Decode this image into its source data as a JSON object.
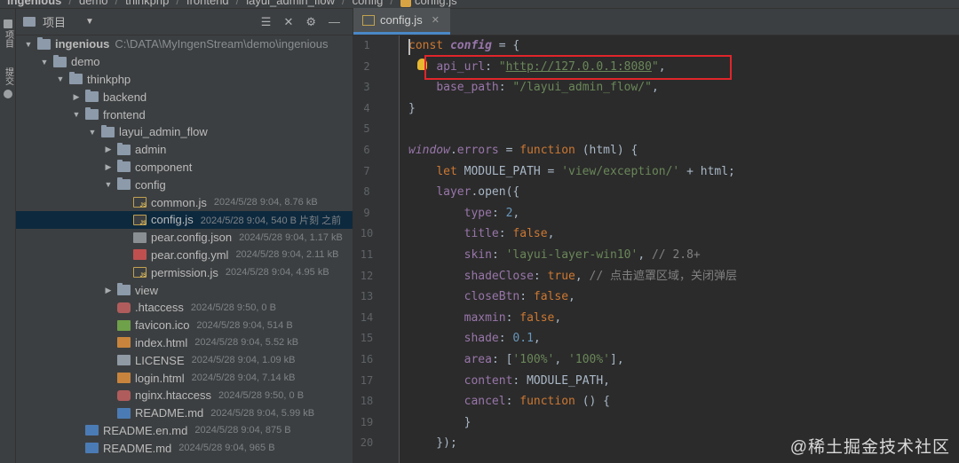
{
  "breadcrumb": {
    "items": [
      "ingenious",
      "demo",
      "thinkphp",
      "frontend",
      "layui_admin_flow",
      "config",
      "config.js"
    ]
  },
  "toolstrip": {
    "project_label": "项目",
    "commit_label": "提交"
  },
  "project_panel": {
    "title": "项目",
    "tree": [
      {
        "name": "ingenious",
        "path": "C:\\DATA\\MyIngenStream\\demo\\ingenious",
        "meta": "",
        "type": "folder",
        "depth": 0,
        "expanded": true
      },
      {
        "name": "demo",
        "path": "",
        "meta": "",
        "type": "folder",
        "depth": 1,
        "expanded": true
      },
      {
        "name": "thinkphp",
        "path": "",
        "meta": "",
        "type": "folder",
        "depth": 2,
        "expanded": true
      },
      {
        "name": "backend",
        "path": "",
        "meta": "",
        "type": "folder",
        "depth": 3,
        "expanded": false
      },
      {
        "name": "frontend",
        "path": "",
        "meta": "",
        "type": "folder",
        "depth": 3,
        "expanded": true
      },
      {
        "name": "layui_admin_flow",
        "path": "",
        "meta": "",
        "type": "folder",
        "depth": 4,
        "expanded": true
      },
      {
        "name": "admin",
        "path": "",
        "meta": "",
        "type": "folder",
        "depth": 5,
        "expanded": false
      },
      {
        "name": "component",
        "path": "",
        "meta": "",
        "type": "folder",
        "depth": 5,
        "expanded": false
      },
      {
        "name": "config",
        "path": "",
        "meta": "",
        "type": "folder",
        "depth": 5,
        "expanded": true
      },
      {
        "name": "common.js",
        "path": "",
        "meta": "2024/5/28 9:04, 8.76 kB",
        "type": "js",
        "depth": 6
      },
      {
        "name": "config.js",
        "path": "",
        "meta": "2024/5/28 9:04, 540 B 片刻 之前",
        "type": "js",
        "depth": 6,
        "selected": true
      },
      {
        "name": "pear.config.json",
        "path": "",
        "meta": "2024/5/28 9:04, 1.17 kB",
        "type": "json",
        "depth": 6
      },
      {
        "name": "pear.config.yml",
        "path": "",
        "meta": "2024/5/28 9:04, 2.11 kB",
        "type": "yml",
        "depth": 6
      },
      {
        "name": "permission.js",
        "path": "",
        "meta": "2024/5/28 9:04, 4.95 kB",
        "type": "js",
        "depth": 6
      },
      {
        "name": "view",
        "path": "",
        "meta": "",
        "type": "folder",
        "depth": 5,
        "expanded": false
      },
      {
        "name": ".htaccess",
        "path": "",
        "meta": "2024/5/28 9:50, 0 B",
        "type": "ht",
        "depth": 5
      },
      {
        "name": "favicon.ico",
        "path": "",
        "meta": "2024/5/28 9:04, 514 B",
        "type": "ico",
        "depth": 5
      },
      {
        "name": "index.html",
        "path": "",
        "meta": "2024/5/28 9:04, 5.52 kB",
        "type": "html",
        "depth": 5
      },
      {
        "name": "LICENSE",
        "path": "",
        "meta": "2024/5/28 9:04, 1.09 kB",
        "type": "lic",
        "depth": 5
      },
      {
        "name": "login.html",
        "path": "",
        "meta": "2024/5/28 9:04, 7.14 kB",
        "type": "html",
        "depth": 5
      },
      {
        "name": "nginx.htaccess",
        "path": "",
        "meta": "2024/5/28 9:50, 0 B",
        "type": "ht",
        "depth": 5
      },
      {
        "name": "README.md",
        "path": "",
        "meta": "2024/5/28 9:04, 5.99 kB",
        "type": "md",
        "depth": 5
      },
      {
        "name": "README.en.md",
        "path": "",
        "meta": "2024/5/28 9:04, 875 B",
        "type": "md",
        "depth": 3
      },
      {
        "name": "README.md",
        "path": "",
        "meta": "2024/5/28 9:04, 965 B",
        "type": "md",
        "depth": 3
      }
    ]
  },
  "editor": {
    "tab_label": "config.js",
    "line_numbers": [
      "1",
      "2",
      "3",
      "4",
      "5",
      "6",
      "7",
      "8",
      "9",
      "10",
      "11",
      "12",
      "13",
      "14",
      "15",
      "16",
      "17",
      "18",
      "19",
      "20"
    ]
  },
  "watermark": "@稀土掘金技术社区",
  "colors": {
    "highlight_box": "#e0252b",
    "selection": "#0d293e",
    "keyword": "#cc7832",
    "string": "#6a8759",
    "number": "#6897bb",
    "property": "#9876aa"
  }
}
